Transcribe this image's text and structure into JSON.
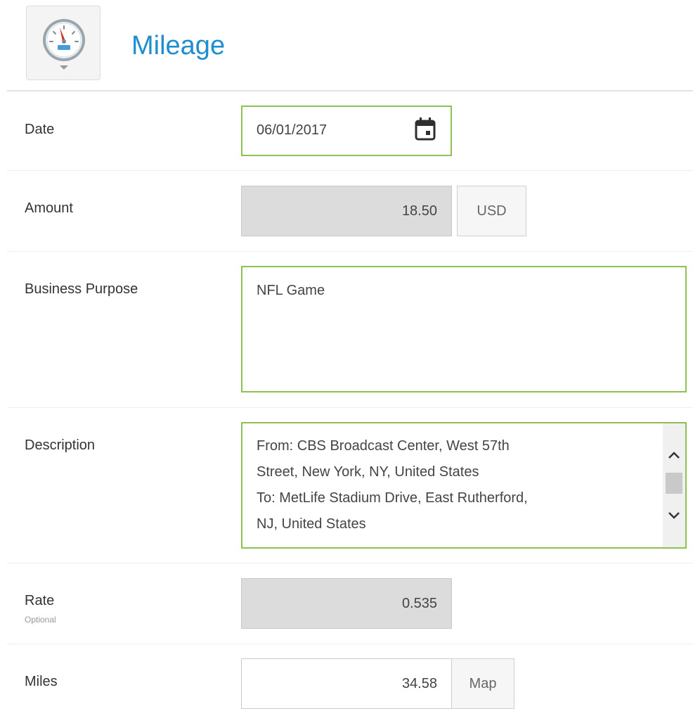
{
  "header": {
    "title": "Mileage",
    "icon": "speedometer-icon"
  },
  "form": {
    "date": {
      "label": "Date",
      "value": "06/01/2017",
      "icon": "calendar-icon"
    },
    "amount": {
      "label": "Amount",
      "value": "18.50",
      "currency": "USD"
    },
    "business_purpose": {
      "label": "Business Purpose",
      "value": "NFL Game"
    },
    "description": {
      "label": "Description",
      "value": "From: CBS Broadcast Center, West 57th\nStreet, New York, NY, United States\nTo: MetLife Stadium Drive, East Rutherford,\nNJ, United States"
    },
    "rate": {
      "label": "Rate",
      "hint": "Optional",
      "value": "0.535"
    },
    "miles": {
      "label": "Miles",
      "value": "34.58",
      "map_label": "Map"
    }
  },
  "colors": {
    "accent": "#1f8ed0",
    "focus_border": "#8dc152",
    "readonly_bg": "#dcdcdc"
  }
}
